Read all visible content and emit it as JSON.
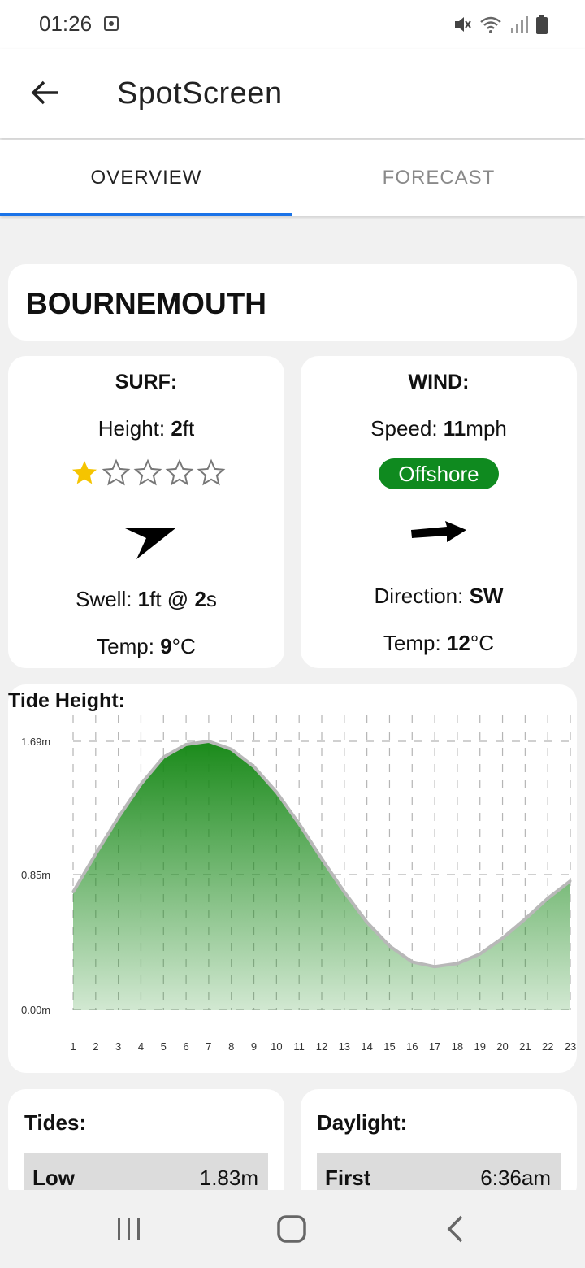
{
  "status": {
    "time": "01:26"
  },
  "header": {
    "title": "SpotScreen"
  },
  "tabs": [
    {
      "label": "OVERVIEW"
    },
    {
      "label": "FORECAST"
    }
  ],
  "spot": {
    "name": "BOURNEMOUTH"
  },
  "surf": {
    "heading": "SURF:",
    "height_label": "Height: ",
    "height_value": "2",
    "height_unit": "ft",
    "rating": 1,
    "rating_max": 5,
    "swell_label": "Swell: ",
    "swell_height": "1",
    "swell_mid": "ft @ ",
    "swell_period": "2",
    "swell_unit": "s",
    "temp_label": "Temp: ",
    "temp_value": "9",
    "temp_unit": "°C"
  },
  "wind": {
    "heading": "WIND:",
    "speed_label": "Speed: ",
    "speed_value": "11",
    "speed_unit": "mph",
    "badge": "Offshore",
    "direction_label": "Direction: ",
    "direction_value": "SW",
    "temp_label": "Temp: ",
    "temp_value": "12",
    "temp_unit": "°C"
  },
  "tide": {
    "title": "Tide Height:",
    "chart_data": {
      "type": "area",
      "x": [
        1,
        2,
        3,
        4,
        5,
        6,
        7,
        8,
        9,
        10,
        11,
        12,
        13,
        14,
        15,
        16,
        17,
        18,
        19,
        20,
        21,
        22,
        23
      ],
      "y": [
        0.74,
        0.98,
        1.21,
        1.42,
        1.59,
        1.67,
        1.69,
        1.64,
        1.53,
        1.37,
        1.17,
        0.95,
        0.74,
        0.55,
        0.4,
        0.3,
        0.27,
        0.29,
        0.35,
        0.45,
        0.57,
        0.7,
        0.81
      ],
      "y_ticks": [
        "0.00m",
        "0.85m",
        "1.69m"
      ],
      "y_tick_values": [
        0,
        0.85,
        1.69
      ],
      "ylim": [
        0,
        1.69
      ],
      "grid": true,
      "color": "#1a8a1a"
    }
  },
  "tides_card": {
    "title": "Tides:",
    "row_label": "Low",
    "row_value": "1.83m"
  },
  "daylight_card": {
    "title": "Daylight:",
    "row_label": "First",
    "row_value": "6:36am"
  },
  "colors": {
    "accent": "#1a73e8",
    "badge": "#0f8a1f",
    "star": "#f5c400"
  }
}
